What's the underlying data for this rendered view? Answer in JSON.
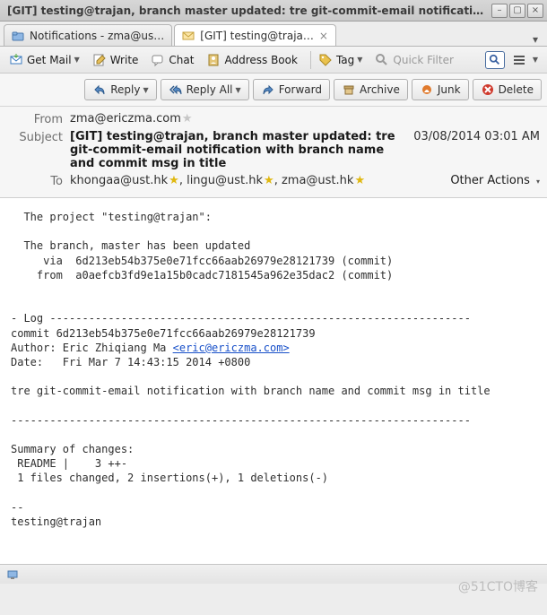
{
  "window": {
    "title": "[GIT] testing@trajan, branch master updated: tre git-commit-email notification with branch na…"
  },
  "tabs": {
    "notifications": {
      "label": "Notifications - zma@us…"
    },
    "message": {
      "label": "[GIT] testing@traja…"
    }
  },
  "toolbar": {
    "get_mail": "Get Mail",
    "write": "Write",
    "chat": "Chat",
    "address_book": "Address Book",
    "tag": "Tag",
    "quick_filter": "Quick Filter"
  },
  "actions": {
    "reply": "Reply",
    "reply_all": "Reply All",
    "forward": "Forward",
    "archive": "Archive",
    "junk": "Junk",
    "delete": "Delete"
  },
  "headers": {
    "from_label": "From",
    "from_value": "zma@ericzma.com",
    "subject_label": "Subject",
    "subject_value": "[GIT] testing@trajan, branch master updated: tre git-commit-email notification with branch name and commit msg in title",
    "datetime": "03/08/2014 03:01 AM",
    "to_label": "To",
    "to_values": [
      "khongaa@ust.hk",
      "lingu@ust.hk",
      "zma@ust.hk"
    ],
    "other_actions": "Other Actions"
  },
  "body": {
    "pre": "  The project \"testing@trajan\":\n\n  The branch, master has been updated\n     via  6d213eb54b375e0e71fcc66aab26979e28121739 (commit)\n    from  a0aefcb3fd9e1a15b0cadc7181545a962e35dac2 (commit)\n\n\n- Log -----------------------------------------------------------------\ncommit 6d213eb54b375e0e71fcc66aab26979e28121739\nAuthor: Eric Zhiqiang Ma ",
    "email": "<eric@ericzma.com>",
    "post": "\nDate:   Fri Mar 7 14:43:15 2014 +0800\n\ntre git-commit-email notification with branch name and commit msg in title\n\n-----------------------------------------------------------------------\n\nSummary of changes:\n README |    3 ++-\n 1 files changed, 2 insertions(+), 1 deletions(-)\n\n-- \ntesting@trajan"
  },
  "watermark": "@51CTO博客"
}
